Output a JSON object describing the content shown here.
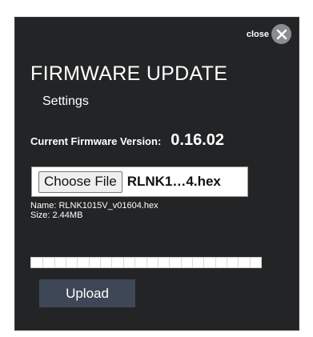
{
  "close": {
    "label": "close",
    "icon": "close-x-icon"
  },
  "header": {
    "title": "FIRMWARE UPDATE",
    "subtitle": "Settings"
  },
  "firmware": {
    "current_label": "Current Firmware Version:",
    "current_version": "0.16.02"
  },
  "file_input": {
    "button_label": "Choose File",
    "selected_display": "RLNK1…4.hex",
    "name_line": "Name: RLNK1015V_v01604.hex",
    "size_line": "Size: 2.44MB"
  },
  "progress": {
    "fraction": 0
  },
  "upload": {
    "label": "Upload"
  },
  "colors": {
    "panel_bg": "#232426",
    "upload_bg": "#3d4755",
    "close_circle": "#8b8c8e"
  }
}
